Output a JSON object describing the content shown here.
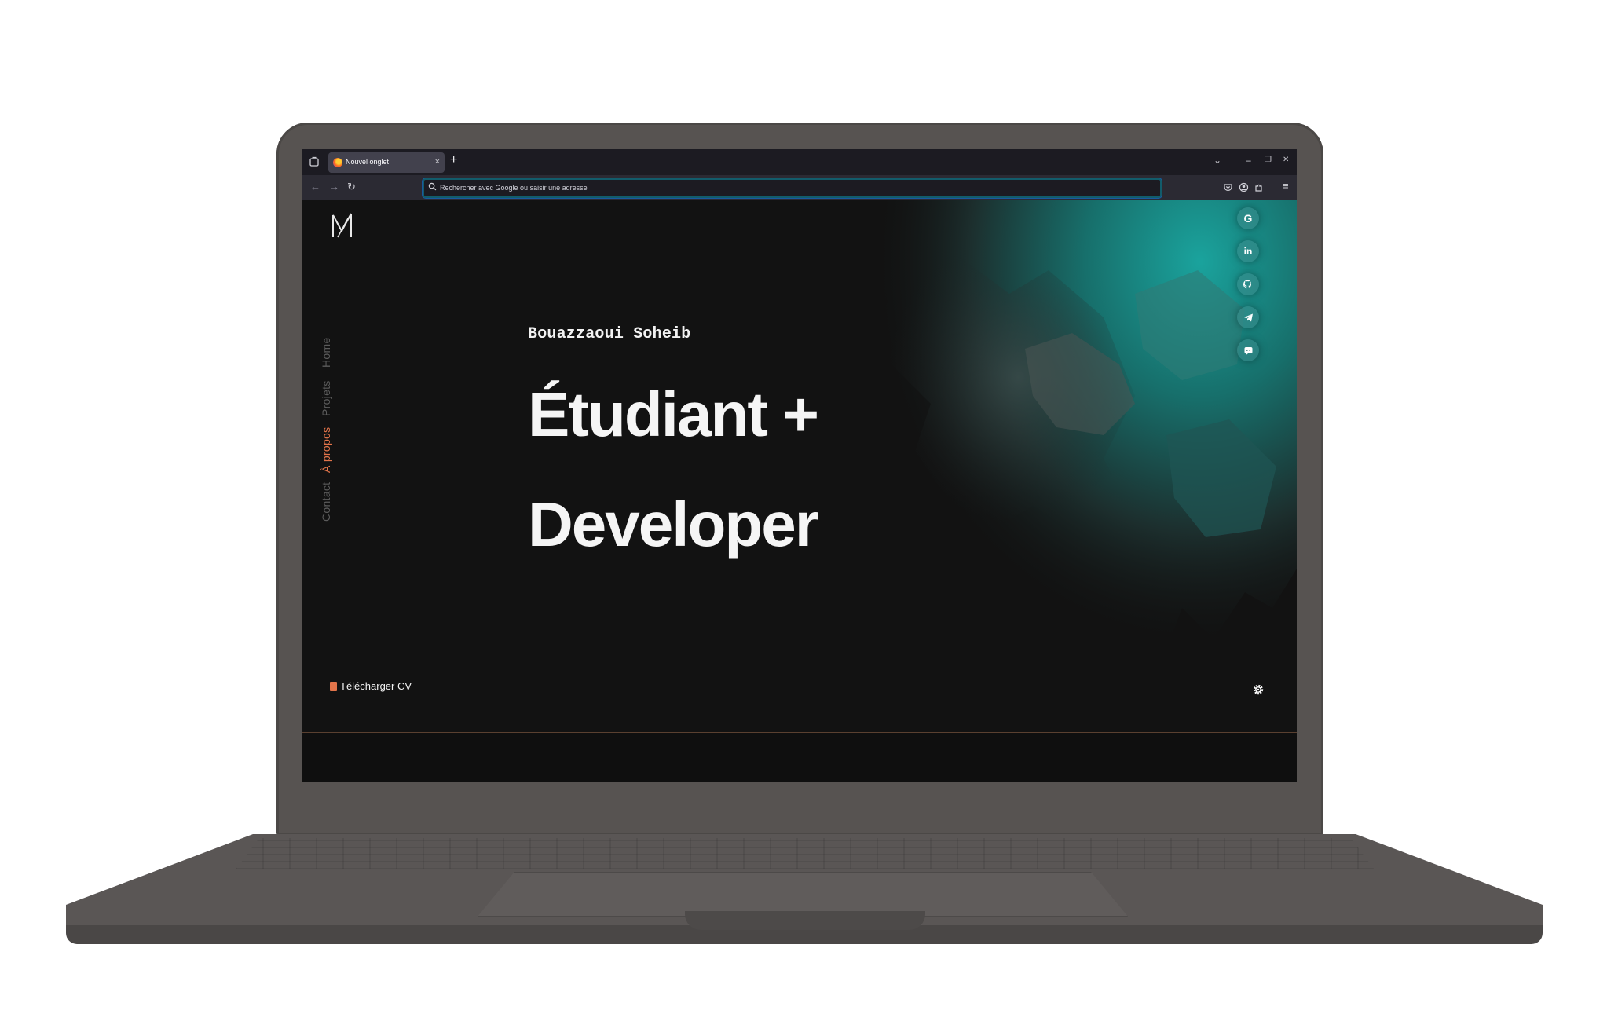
{
  "browser": {
    "tab_title": "Nouvel onglet",
    "tab_close": "×",
    "new_tab": "+",
    "controls": {
      "list_all_tabs": "⌄",
      "minimize": "–",
      "restore": "❐",
      "close": "✕"
    },
    "nav": {
      "back": "←",
      "forward": "→",
      "reload": "↻"
    },
    "urlbar_placeholder": "Rechercher avec Google ou saisir une adresse",
    "menu": "≡"
  },
  "site": {
    "nav_items": [
      "Home",
      "Projets",
      "À propos",
      "Contact"
    ],
    "active_nav": "À propos",
    "hero_name": "Bouazzaoui Soheib",
    "hero_line1": "Étudiant +",
    "hero_line2": "Developer",
    "cv_button": "Télécharger CV",
    "socials": [
      {
        "icon": "google-icon",
        "glyph": "G"
      },
      {
        "icon": "linkedin-icon",
        "glyph": "in"
      },
      {
        "icon": "github-icon",
        "glyph": ""
      },
      {
        "icon": "telegram-icon",
        "glyph": ""
      },
      {
        "icon": "discord-icon",
        "glyph": ""
      }
    ]
  },
  "colors": {
    "accent": "#e2744a",
    "background": "#121212",
    "teal": "#1a8a86",
    "laptop": "#575351"
  }
}
